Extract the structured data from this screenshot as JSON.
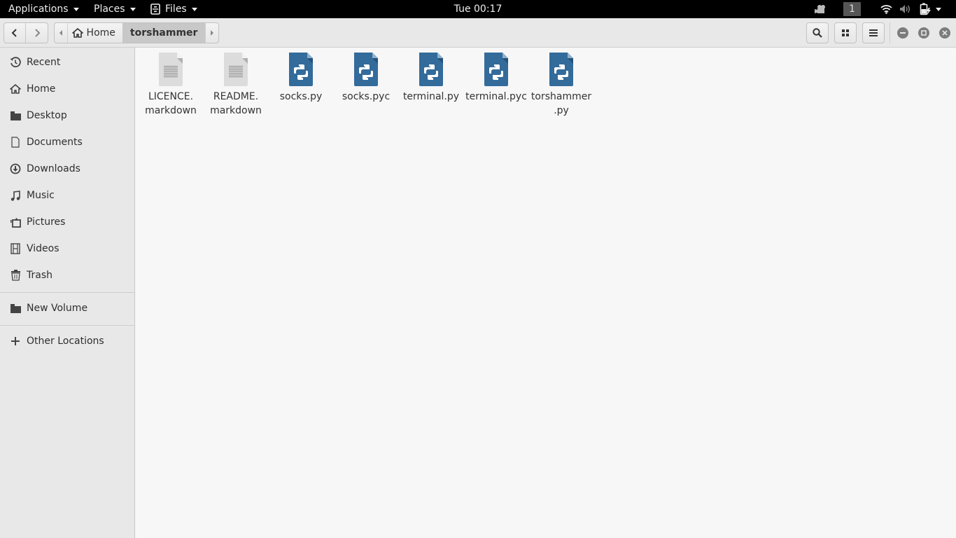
{
  "topbar": {
    "applications_label": "Applications",
    "places_label": "Places",
    "files_label": "Files",
    "clock": "Tue 00:17",
    "workspace": "1"
  },
  "headerbar": {
    "path": [
      {
        "label": "Home",
        "icon": "home-icon"
      },
      {
        "label": "torshammer",
        "current": true
      }
    ],
    "buttons": [
      "search",
      "view-toggle",
      "menu"
    ],
    "window_controls": [
      "minimize",
      "maximize",
      "close"
    ]
  },
  "sidebar": {
    "items": [
      {
        "label": "Recent",
        "icon": "clock-icon"
      },
      {
        "label": "Home",
        "icon": "home-icon"
      },
      {
        "label": "Desktop",
        "icon": "folder-icon"
      },
      {
        "label": "Documents",
        "icon": "document-icon"
      },
      {
        "label": "Downloads",
        "icon": "download-icon"
      },
      {
        "label": "Music",
        "icon": "music-icon"
      },
      {
        "label": "Pictures",
        "icon": "pictures-icon"
      },
      {
        "label": "Videos",
        "icon": "film-icon"
      },
      {
        "label": "Trash",
        "icon": "trash-icon"
      }
    ],
    "devices": [
      {
        "label": "New Volume",
        "icon": "folder-icon"
      }
    ],
    "other": {
      "label": "Other Locations",
      "icon": "plus-icon"
    }
  },
  "files": [
    {
      "name": "LICENCE.\nmarkdown",
      "line1": "LICENCE.",
      "line2": "markdown",
      "type": "text"
    },
    {
      "name": "README.\nmarkdown",
      "line1": "README.",
      "line2": "markdown",
      "type": "text"
    },
    {
      "name": "socks.py",
      "line1": "socks.py",
      "line2": "",
      "type": "python"
    },
    {
      "name": "socks.pyc",
      "line1": "socks.pyc",
      "line2": "",
      "type": "python"
    },
    {
      "name": "terminal.py",
      "line1": "terminal.py",
      "line2": "",
      "type": "python"
    },
    {
      "name": "terminal.pyc",
      "line1": "terminal.pyc",
      "line2": "",
      "type": "python"
    },
    {
      "name": "torshammer.py",
      "line1": "torshammer",
      "line2": ".py",
      "type": "python"
    }
  ],
  "colors": {
    "python_icon": "#336b9b",
    "text_icon": "#dcdcdc",
    "accent": "#3a6ea5"
  }
}
